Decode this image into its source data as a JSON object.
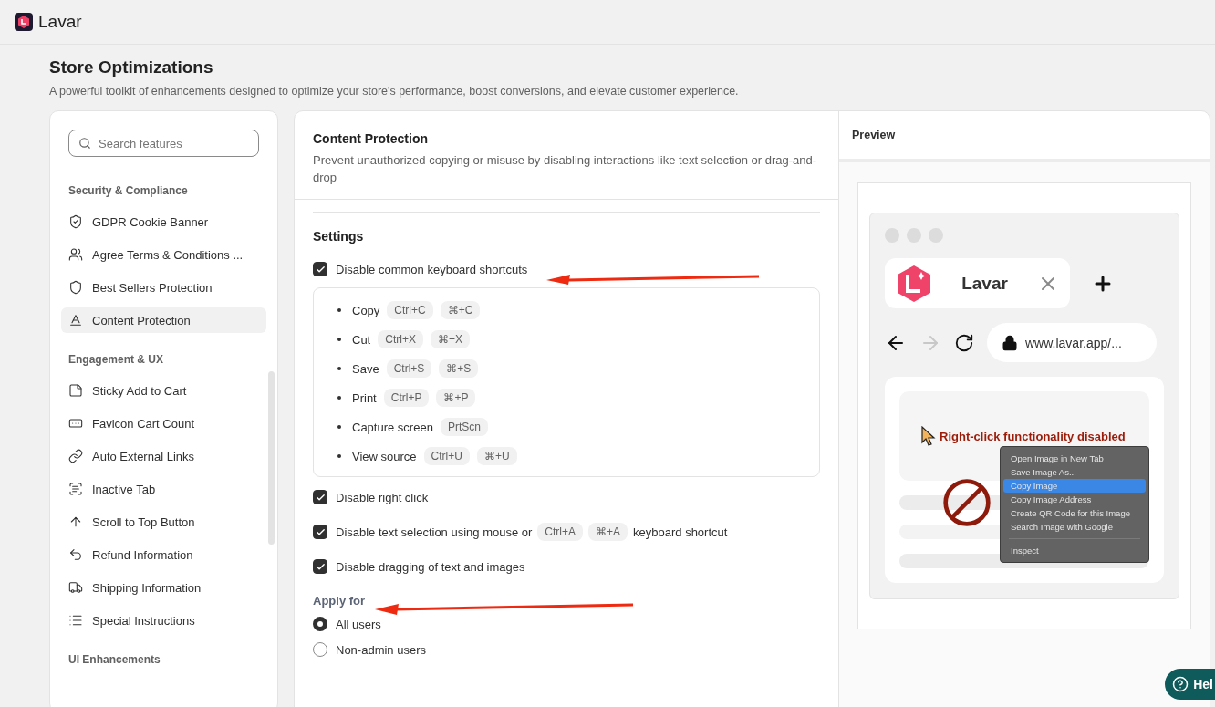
{
  "app": {
    "name": "Lavar"
  },
  "page": {
    "title": "Store Optimizations",
    "subtitle": "A powerful toolkit of enhancements designed to optimize your store's performance, boost conversions, and elevate customer experience."
  },
  "sidebar": {
    "search": {
      "placeholder": "Search features"
    },
    "groups": [
      {
        "title": "Security & Compliance",
        "items": [
          {
            "label": "GDPR Cookie Banner",
            "selected": false
          },
          {
            "label": "Agree Terms & Conditions ...",
            "selected": false
          },
          {
            "label": "Best Sellers Protection",
            "selected": false
          },
          {
            "label": "Content Protection",
            "selected": true
          }
        ]
      },
      {
        "title": "Engagement & UX",
        "items": [
          {
            "label": "Sticky Add to Cart",
            "selected": false
          },
          {
            "label": "Favicon Cart Count",
            "selected": false
          },
          {
            "label": "Auto External Links",
            "selected": false
          },
          {
            "label": "Inactive Tab",
            "selected": false
          },
          {
            "label": "Scroll to Top Button",
            "selected": false
          },
          {
            "label": "Refund Information",
            "selected": false
          },
          {
            "label": "Shipping Information",
            "selected": false
          },
          {
            "label": "Special Instructions",
            "selected": false
          }
        ]
      },
      {
        "title": "UI Enhancements"
      }
    ]
  },
  "content": {
    "title": "Content Protection",
    "description": "Prevent unauthorized copying or misuse by disabling interactions like text selection or drag-and-drop",
    "settings": {
      "title": "Settings",
      "options": [
        {
          "kind": "shortcuts",
          "label": "Disable common keyboard shortcuts",
          "checked": true,
          "shortcuts": [
            {
              "action": "Copy",
              "keys": [
                "Ctrl+C",
                "⌘+C"
              ]
            },
            {
              "action": "Cut",
              "keys": [
                "Ctrl+X",
                "⌘+X"
              ]
            },
            {
              "action": "Save",
              "keys": [
                "Ctrl+S",
                "⌘+S"
              ]
            },
            {
              "action": "Print",
              "keys": [
                "Ctrl+P",
                "⌘+P"
              ]
            },
            {
              "action": "Capture screen",
              "keys": [
                "PrtScn"
              ]
            },
            {
              "action": "View source",
              "keys": [
                "Ctrl+U",
                "⌘+U"
              ]
            }
          ]
        },
        {
          "kind": "plain",
          "label": "Disable right click",
          "checked": true
        },
        {
          "kind": "inline_keys",
          "label": "Disable text selection using mouse or",
          "keys": [
            "Ctrl+A",
            "⌘+A"
          ],
          "label_after": "keyboard shortcut",
          "checked": true
        },
        {
          "kind": "plain",
          "label": "Disable dragging of text and images",
          "checked": true
        }
      ]
    },
    "apply_for": {
      "title": "Apply for",
      "options": [
        {
          "label": "All users",
          "selected": true
        },
        {
          "label": "Non-admin users",
          "selected": false
        }
      ]
    }
  },
  "preview": {
    "title": "Preview",
    "tab_title": "Lavar",
    "url": "www.lavar.app/...",
    "message": "Right-click functionality disabled",
    "context_menu": [
      {
        "kind": "item",
        "label": "Open Image in New Tab",
        "highlighted": false
      },
      {
        "kind": "item",
        "label": "Save Image As...",
        "highlighted": false
      },
      {
        "kind": "item",
        "label": "Copy Image",
        "highlighted": true
      },
      {
        "kind": "item",
        "label": "Copy Image Address",
        "highlighted": false
      },
      {
        "kind": "item",
        "label": "Create QR Code for this Image",
        "highlighted": false
      },
      {
        "kind": "item",
        "label": "Search Image with Google",
        "highlighted": false
      },
      {
        "kind": "separator"
      },
      {
        "kind": "item",
        "label": "Inspect",
        "highlighted": false
      }
    ]
  },
  "help": {
    "label": "Hel"
  }
}
